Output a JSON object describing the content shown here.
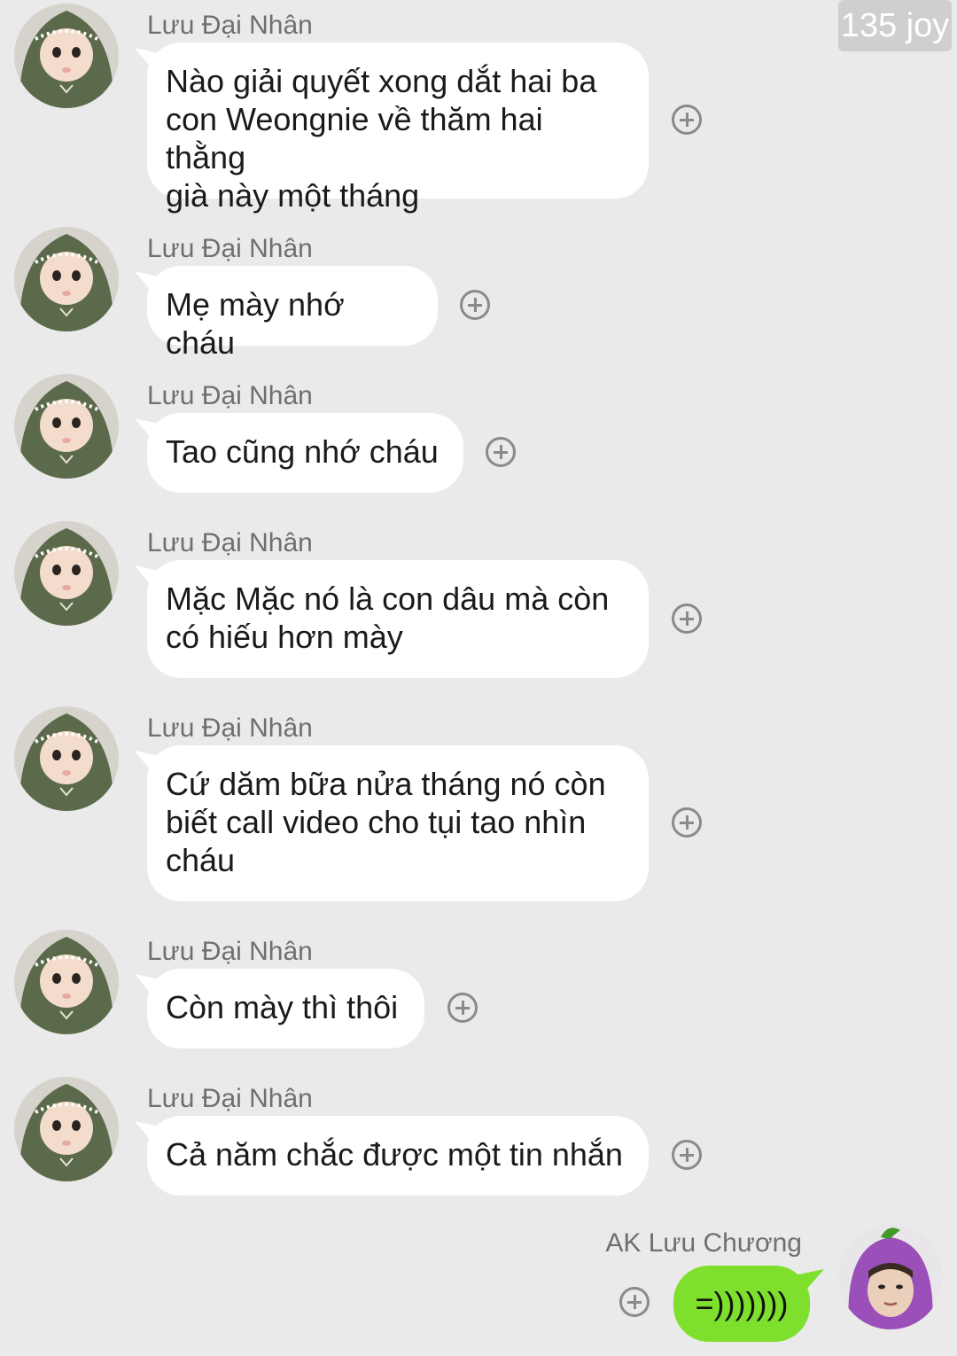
{
  "watermark": "135 joy",
  "messages": [
    {
      "sender": "Lưu Đại Nhân",
      "lines": [
        "Nào giải quyết xong dắt hai ba",
        "con Weongnie về thăm hai thằng",
        "già này một tháng"
      ]
    },
    {
      "sender": "Lưu Đại Nhân",
      "lines": [
        "Mẹ mày nhớ cháu"
      ]
    },
    {
      "sender": "Lưu Đại Nhân",
      "lines": [
        "Tao cũng nhớ cháu"
      ]
    },
    {
      "sender": "Lưu Đại Nhân",
      "lines": [
        "Mặc Mặc nó là con dâu mà còn",
        "có hiếu hơn mày"
      ]
    },
    {
      "sender": "Lưu Đại Nhân",
      "lines": [
        "Cứ dăm bữa nửa tháng nó còn",
        "biết call video cho tụi tao nhìn",
        "cháu"
      ]
    },
    {
      "sender": "Lưu Đại Nhân",
      "lines": [
        "Còn mày thì thôi"
      ]
    },
    {
      "sender": "Lưu Đại Nhân",
      "lines": [
        "Cả năm chắc được một tin nhắn"
      ]
    }
  ],
  "reply": {
    "sender": "AK Lưu Chương",
    "text": "=)))))))"
  },
  "icons": {
    "add_reaction": "plus-circle-icon",
    "avatar_baby": "baby-hood-avatar",
    "avatar_eggplant": "eggplant-hat-avatar"
  },
  "colors": {
    "background": "#eaeaea",
    "incoming_bubble": "#ffffff",
    "outgoing_bubble": "#7ee02d"
  }
}
